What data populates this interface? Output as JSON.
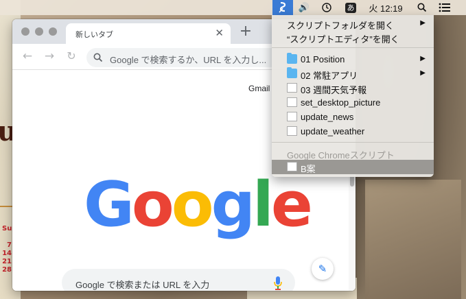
{
  "menubar": {
    "clock": "火 12:19",
    "input_method": "あ"
  },
  "chrome": {
    "tab_title": "新しいタブ",
    "new_tab": "+",
    "omnibox_placeholder": "Google で検索するか、URL を入力し...",
    "gmail": "Gmail",
    "search_placeholder": "Google で検索または URL を入力",
    "logo": [
      "G",
      "o",
      "o",
      "g",
      "l",
      "e"
    ]
  },
  "script_menu": {
    "open_folder": "スクリプトフォルダを開く",
    "open_editor": "“スクリプトエディタ”を開く",
    "items": [
      {
        "label": "01 Position",
        "icon": "folder-icon",
        "submenu": true
      },
      {
        "label": "02 常駐アプリ",
        "icon": "folder-icon",
        "submenu": true
      },
      {
        "label": "03 週間天気予報",
        "icon": "script-file-icon"
      },
      {
        "label": "set_desktop_picture",
        "icon": "script-file-icon"
      },
      {
        "label": "update_news",
        "icon": "script-file-icon"
      },
      {
        "label": "update_weather",
        "icon": "script-file-icon"
      }
    ],
    "section_header": "Google Chromeスクリプト",
    "highlighted_item": "B案"
  },
  "wallpaper": {
    "calendar": [
      "Su",
      "7",
      "14",
      "21",
      "28"
    ]
  }
}
